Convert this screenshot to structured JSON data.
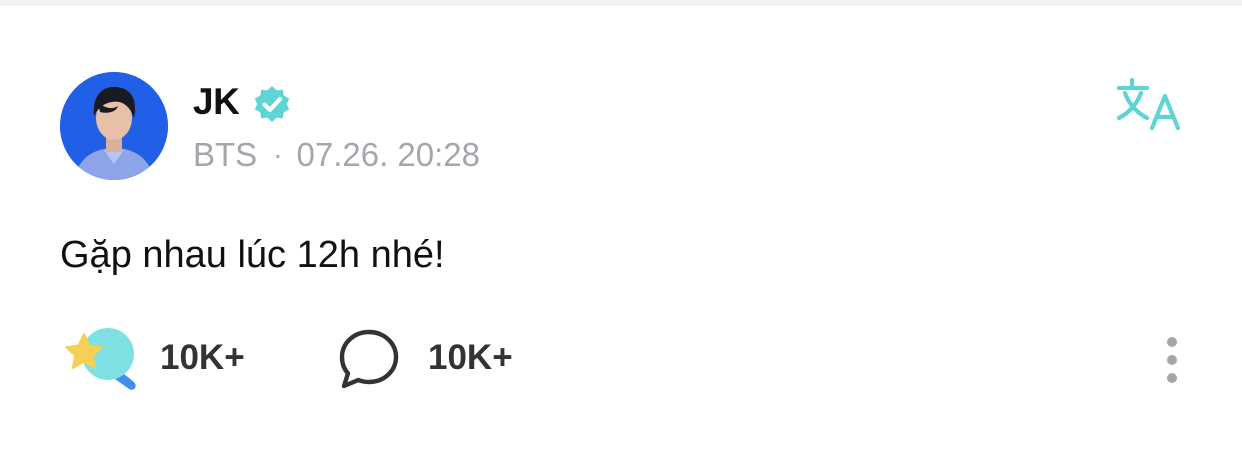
{
  "post": {
    "author": {
      "name": "JK",
      "verified": true,
      "group": "BTS"
    },
    "meta_separator": "·",
    "timestamp": "07.26. 20:28",
    "text": "Gặp nhau lúc 12h nhé!",
    "reactions": {
      "like_count": "10K+",
      "comment_count": "10K+"
    }
  },
  "icons": {
    "verified": "verified-badge-icon",
    "translate": "translate-icon",
    "like": "star-rocket-icon",
    "comment": "speech-bubble-icon",
    "more": "vertical-ellipsis-icon"
  },
  "colors": {
    "accent": "#5fd3d6",
    "name_text": "#111111",
    "meta_text": "#a4a6ab",
    "count_text": "#333333",
    "avatar_background": "#1c4fd8",
    "star": "#f6cf55",
    "like_bubble": "#7fe0e3",
    "like_tail": "#3f8ef0"
  }
}
